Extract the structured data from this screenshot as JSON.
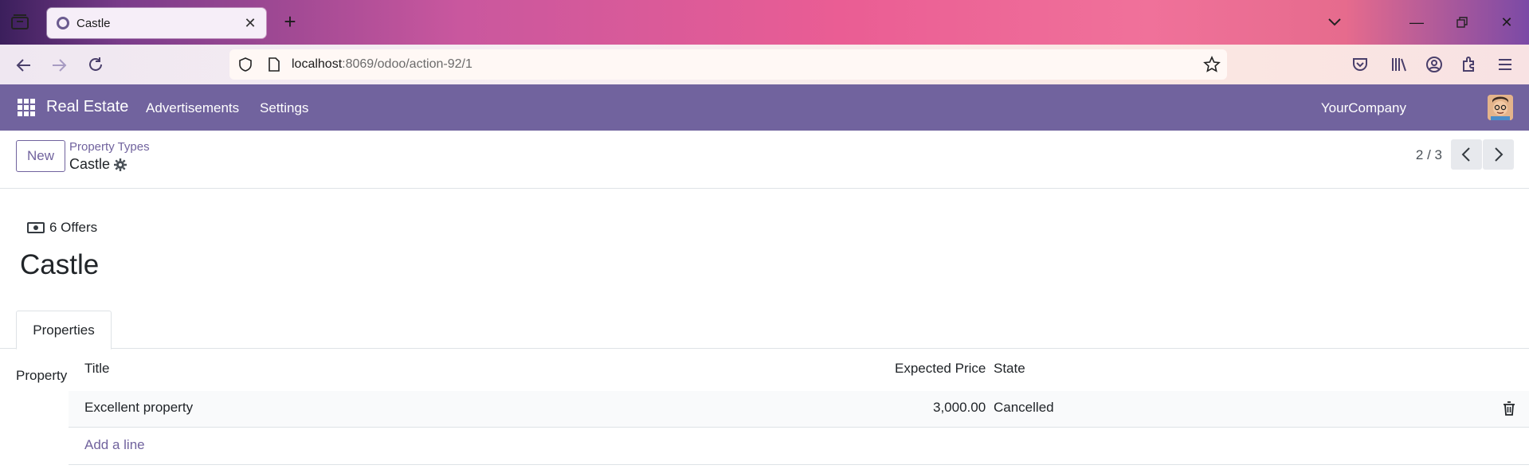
{
  "browser": {
    "tab_title": "Castle",
    "url_host": "localhost",
    "url_rest": ":8069/odoo/action-92/1"
  },
  "app": {
    "brand": "Real Estate",
    "menu": [
      "Advertisements",
      "Settings"
    ],
    "company": "YourCompany"
  },
  "control_panel": {
    "new_label": "New",
    "breadcrumb": "Property Types",
    "record_name": "Castle",
    "pager": "2 / 3"
  },
  "form": {
    "offers_label": "6 Offers",
    "title": "Castle",
    "tabs": [
      "Properties"
    ],
    "field_label": "Property",
    "columns": [
      "Title",
      "Expected Price",
      "State"
    ],
    "rows": [
      {
        "title": "Excellent property",
        "expected_price": "3,000.00",
        "state": "Cancelled"
      }
    ],
    "add_line": "Add a line"
  },
  "colors": {
    "odoo_primary": "#71639e",
    "nav_text": "#ffffff"
  },
  "icons": [
    "tab-list-icon",
    "tab-favicon",
    "close-tab-icon",
    "new-tab-icon",
    "tab-overflow-icon",
    "minimize-icon",
    "restore-icon",
    "close-window-icon",
    "back-icon",
    "forward-icon",
    "reload-icon",
    "shield-icon",
    "page-icon",
    "bookmark-star-icon",
    "pocket-icon",
    "library-icon",
    "account-icon",
    "extensions-icon",
    "menu-icon",
    "apps-grid-icon",
    "gear-icon",
    "chevron-left-icon",
    "chevron-right-icon",
    "money-icon",
    "trash-icon"
  ]
}
